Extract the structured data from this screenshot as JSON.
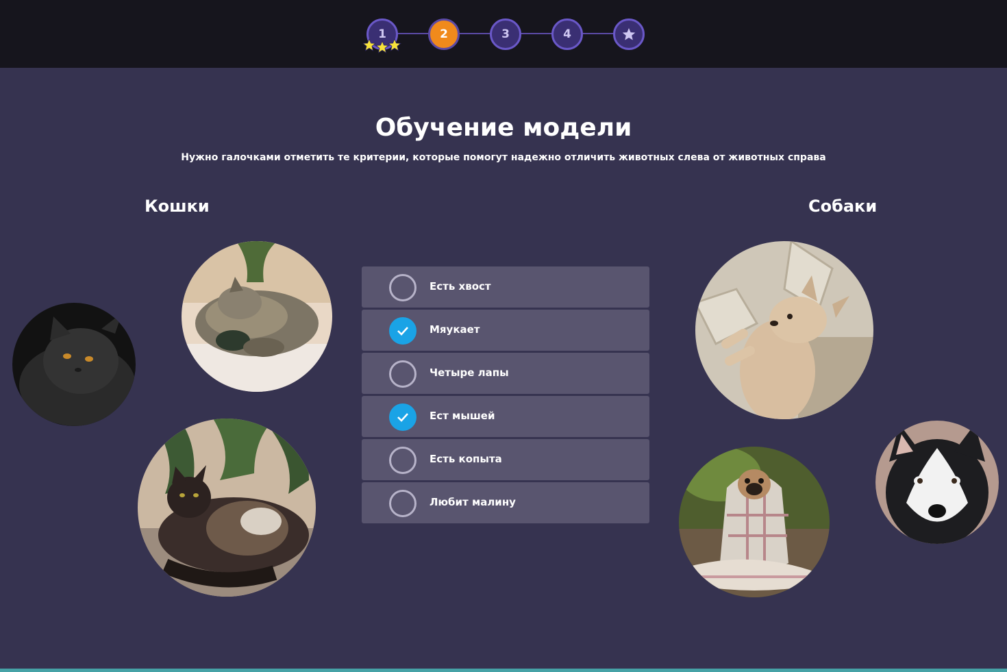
{
  "steps": [
    {
      "label": "1",
      "state": "done",
      "stars": 3
    },
    {
      "label": "2",
      "state": "active"
    },
    {
      "label": "3",
      "state": "pending"
    },
    {
      "label": "4",
      "state": "pending"
    },
    {
      "label": "",
      "icon": "star-icon",
      "state": "pending"
    }
  ],
  "colors": {
    "accent": "#f08a1c",
    "check": "#1aa3e6",
    "panel": "#59556f",
    "background": "#363350",
    "topbar": "#16151d"
  },
  "page": {
    "title": "Обучение модели",
    "subtitle": "Нужно галочками отметить те критерии, которые помогут надежно отличить животных слева от животных справа"
  },
  "groups": {
    "left": {
      "label": "Кошки",
      "photos": [
        "cat-photo-sleeping",
        "cat-photo-black",
        "cat-photo-plant"
      ]
    },
    "right": {
      "label": "Собаки",
      "photos": [
        "dog-photo-chihuahua",
        "dog-photo-husky",
        "dog-photo-pug"
      ]
    }
  },
  "criteria": [
    {
      "label": "Есть хвост",
      "checked": false
    },
    {
      "label": "Мяукает",
      "checked": true
    },
    {
      "label": "Четыре лапы",
      "checked": false
    },
    {
      "label": "Ест мышей",
      "checked": true
    },
    {
      "label": "Есть копыта",
      "checked": false
    },
    {
      "label": "Любит малину",
      "checked": false
    }
  ]
}
